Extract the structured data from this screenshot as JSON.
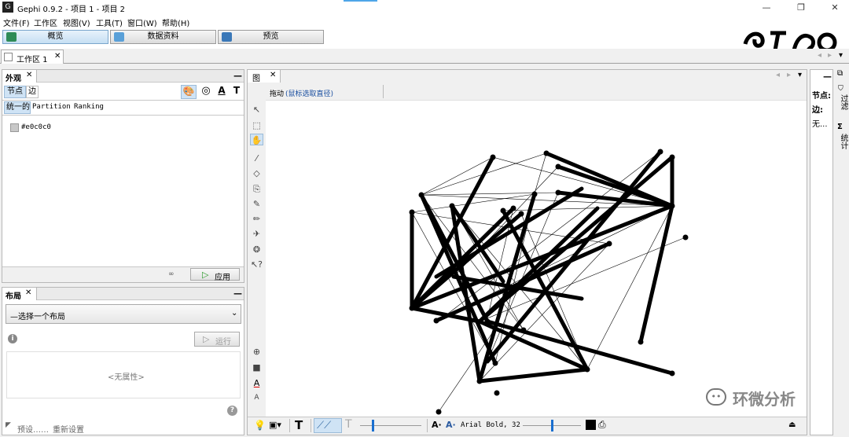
{
  "window": {
    "title": "Gephi 0.9.2 - 项目 1 - 项目 2",
    "app_icon": "gephi-icon"
  },
  "menu": {
    "items": [
      "文件(F)",
      "工作区",
      "视图(V)",
      "工具(T)",
      "窗口(W)",
      "帮助(H)"
    ]
  },
  "modes": {
    "overview": "概览",
    "data": "数据资料",
    "preview": "预览"
  },
  "workspace": {
    "tab": "工作区 1"
  },
  "appearance": {
    "title": "外观",
    "subtabs": [
      "节点",
      "边"
    ],
    "modes": [
      "统一的",
      "Partition",
      "Ranking"
    ],
    "color_value": "#e0c0c0",
    "apply": "应用"
  },
  "layout": {
    "title": "布局",
    "select": "—选择一个布局",
    "run": "运行",
    "no_props": "<无属性>",
    "preset": "预设……",
    "reset": "重新设置"
  },
  "graph": {
    "tab": "图",
    "drag_label": "拖动",
    "drag_hint": "(鼠标选取直径)",
    "font_label": "Arial Bold, 32"
  },
  "context": {
    "nodes_label": "节点:",
    "edges_label": "边:",
    "more": "无..."
  },
  "side": {
    "filter": "过滤",
    "stats": "统计"
  },
  "watermark": "环微分析"
}
